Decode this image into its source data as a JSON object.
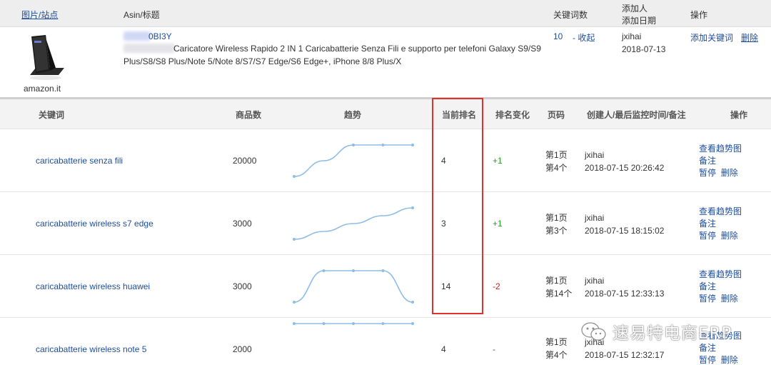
{
  "product_table": {
    "headers": {
      "image_site": "图片/站点",
      "asin_title": "Asin/标题",
      "keyword_count": "关键词数",
      "added_by": "添加人",
      "added_date": "添加日期",
      "actions": "操作"
    },
    "product": {
      "site": "amazon.it",
      "asin": "0BI3Y",
      "title_line1": "Caricatore Wireless Rapido 2 IN 1 Caricabatterie Senza Fili e supporto per telefoni Galaxy S9/S9",
      "title_line2": "Plus/S8/S8 Plus/Note 5/Note 8/S7/S7 Edge/S6 Edge+, iPhone 8/8 Plus/X",
      "keyword_count": "10",
      "collapse_label": "- 收起",
      "added_by": "jxihai",
      "added_date": "2018-07-13",
      "add_keyword_label": "添加关键词",
      "delete_label": "删除"
    }
  },
  "keyword_table": {
    "headers": {
      "keyword": "关键词",
      "product_count": "商品数",
      "trend": "趋势",
      "current_rank": "当前排名",
      "rank_change": "排名变化",
      "page": "页码",
      "creator": "创建人/最后监控时间/备注",
      "actions": "操作"
    },
    "action_labels": {
      "trend_chart": "查看趋势图",
      "note": "备注",
      "pause": "暂停",
      "delete": "删除"
    },
    "rows": [
      {
        "keyword": "caricabatterie senza fili",
        "product_count": "20000",
        "current_rank": "4",
        "rank_change": "+1",
        "change_dir": "up",
        "page": "第1页",
        "position": "第4个",
        "creator": "jxihai",
        "last_monitored": "2018-07-15 20:26:42",
        "trend": [
          8,
          6,
          4,
          4,
          4
        ]
      },
      {
        "keyword": "caricabatterie wireless s7 edge",
        "product_count": "3000",
        "current_rank": "3",
        "rank_change": "+1",
        "change_dir": "up",
        "page": "第1页",
        "position": "第3个",
        "creator": "jxihai",
        "last_monitored": "2018-07-15 18:15:02",
        "trend": [
          7,
          6,
          5,
          4,
          3
        ]
      },
      {
        "keyword": "caricabatterie wireless huawei",
        "product_count": "3000",
        "current_rank": "14",
        "rank_change": "-2",
        "change_dir": "down",
        "page": "第1页",
        "position": "第14个",
        "creator": "jxihai",
        "last_monitored": "2018-07-15 12:33:13",
        "trend": [
          16,
          12,
          12,
          12,
          16
        ]
      },
      {
        "keyword": "caricabatterie wireless note 5",
        "product_count": "2000",
        "current_rank": "4",
        "rank_change": "-",
        "change_dir": "none",
        "page": "第1页",
        "position": "第4个",
        "creator": "jxihai",
        "last_monitored": "2018-07-15 12:32:17",
        "trend": [
          4,
          4,
          4,
          4,
          4
        ]
      }
    ]
  },
  "watermark": {
    "icon": "wechat-icon",
    "text": "速易特电商ERP"
  },
  "colors": {
    "link": "#1f4e9c",
    "rank_up": "#2a9d2a",
    "rank_down": "#d62020",
    "highlight_box": "#e03030",
    "trend_line": "#8fbde6"
  }
}
